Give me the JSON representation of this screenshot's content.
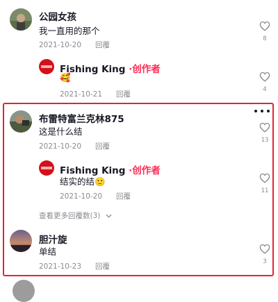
{
  "comments": [
    {
      "user": "公园女孩",
      "text": "我一直用的那个",
      "date": "2021-10-20",
      "reply_label": "回覆",
      "likes": "8",
      "reply": {
        "user": "Fishing King",
        "author_tag": "·创作者",
        "text": "🥰",
        "date": "2021-10-21",
        "reply_label": "回覆",
        "likes": "4"
      }
    },
    {
      "user": "布雷特富兰克林875",
      "text": "这是什么结",
      "date": "2021-10-20",
      "reply_label": "回覆",
      "likes": "13",
      "reply": {
        "user": "Fishing King",
        "author_tag": "·创作者",
        "text": "结实的结🙂",
        "date": "2021-10-20",
        "reply_label": "回覆",
        "likes": "11"
      },
      "view_more": "查看更多回覆数(3)"
    },
    {
      "user": "胆汁旋",
      "text": "单结",
      "date": "2021-10-23",
      "reply_label": "回覆",
      "likes": "3"
    }
  ],
  "colors": {
    "author_tag": "#fe2c55",
    "highlight_border": "#e0252f",
    "meta": "#8a8b91"
  }
}
